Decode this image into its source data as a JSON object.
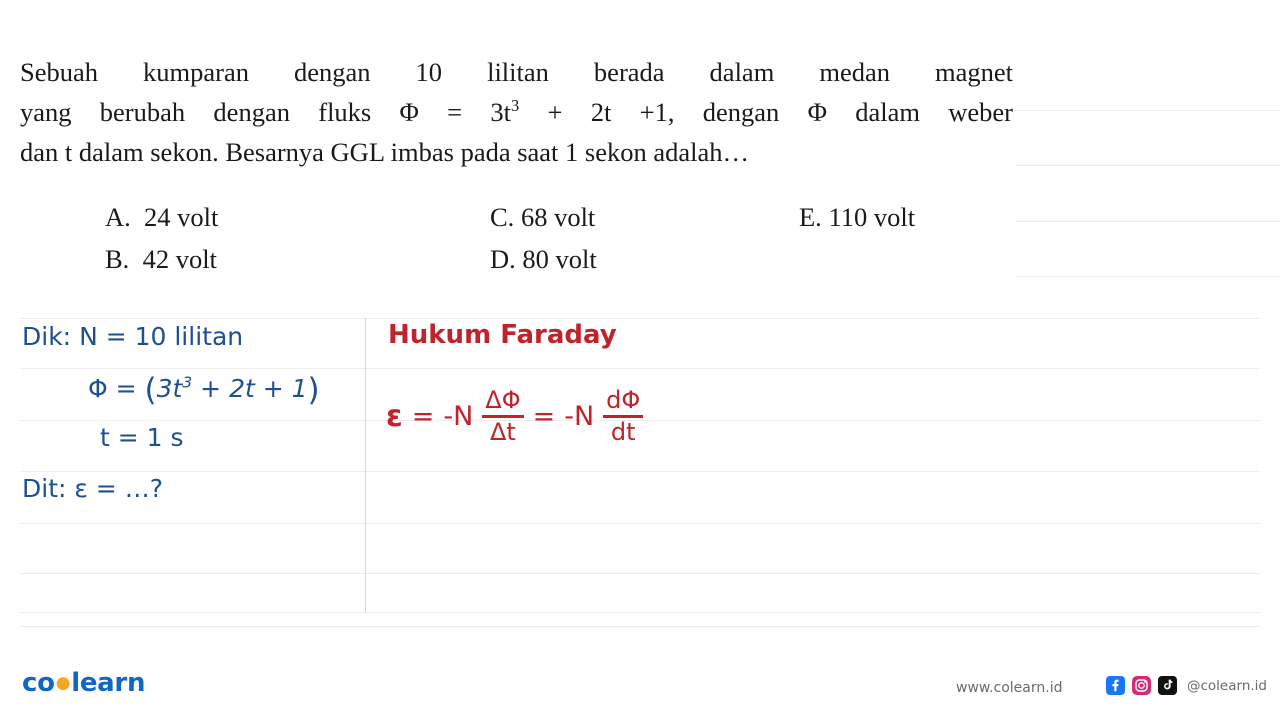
{
  "question": {
    "line1": "Sebuah kumparan dengan 10 lilitan berada dalam medan magnet",
    "line2_a": "yang berubah dengan fluks Φ = 3t",
    "line2_sup": "3",
    "line2_b": " + 2t +1, dengan Φ dalam weber",
    "line3": "dan t dalam sekon. Besarnya GGL imbas pada saat 1 sekon adalah…"
  },
  "options": [
    {
      "label": "A.",
      "text": "24 volt"
    },
    {
      "label": "B.",
      "text": "42 volt"
    },
    {
      "label": "C.",
      "text": "68 volt"
    },
    {
      "label": "D.",
      "text": "80 volt"
    },
    {
      "label": "E.",
      "text": "110 volt"
    }
  ],
  "worksheet": {
    "left": {
      "known_label": "Dik:",
      "known_value": "N = 10 lilitan",
      "phi_label": "Φ =",
      "phi_open": "(",
      "phi_body_a": "3t",
      "phi_body_sup": "3",
      "phi_body_b": " + 2t + 1",
      "phi_close": ")",
      "t_value": "t = 1 s",
      "asked_label": "Dit:",
      "asked_value": "ε = …?"
    },
    "right": {
      "title": "Hukum Faraday",
      "eps": "ε",
      "equals1": "=",
      "minus_n1": "-N",
      "frac1_num": "ΔΦ",
      "frac1_den": "Δt",
      "equals2": "=",
      "minus_n2": "-N",
      "frac2_num": "dΦ",
      "frac2_den": "dt"
    }
  },
  "footer": {
    "logo_co": "co",
    "logo_dot": "●",
    "logo_learn": "learn",
    "site": "www.colearn.id",
    "handle": "@colearn.id",
    "socials": [
      "facebook-icon",
      "instagram-icon",
      "tiktok-icon"
    ]
  },
  "colors": {
    "ink_blue": "#1d4f91",
    "ink_red": "#c0232b",
    "brand_blue": "#1266c4",
    "brand_orange": "#f5a623"
  }
}
